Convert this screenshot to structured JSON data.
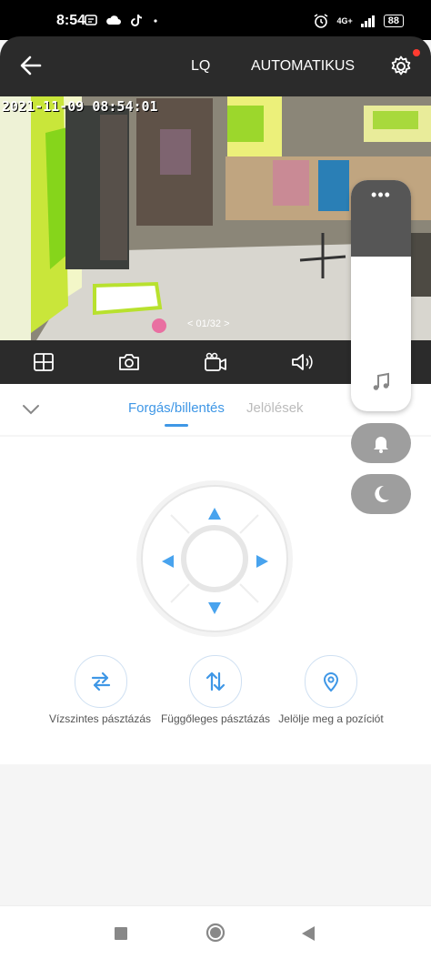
{
  "status_bar": {
    "time": "8:54",
    "network": "4G+",
    "battery": "88"
  },
  "header": {
    "quality": "LQ",
    "mode": "AUTOMATIKUS"
  },
  "video": {
    "timestamp": "2021-11-09 08:54:01",
    "page_indicator": "01/32"
  },
  "tabs": [
    {
      "label": "Forgás/billentés",
      "active": true
    },
    {
      "label": "Jelölések",
      "active": false
    }
  ],
  "actions": [
    {
      "label": "Vízszintes pásztázás",
      "icon": "horizontal-swap-icon"
    },
    {
      "label": "Függőleges pásztázás",
      "icon": "vertical-swap-icon"
    },
    {
      "label": "Jelölje meg a pozíciót",
      "icon": "location-pin-icon"
    }
  ],
  "floating_menu": {
    "more": "•••"
  },
  "colors": {
    "accent": "#3f97e6",
    "dark_bar": "#2b2b2b",
    "notification_dot": "#ff3b30"
  }
}
